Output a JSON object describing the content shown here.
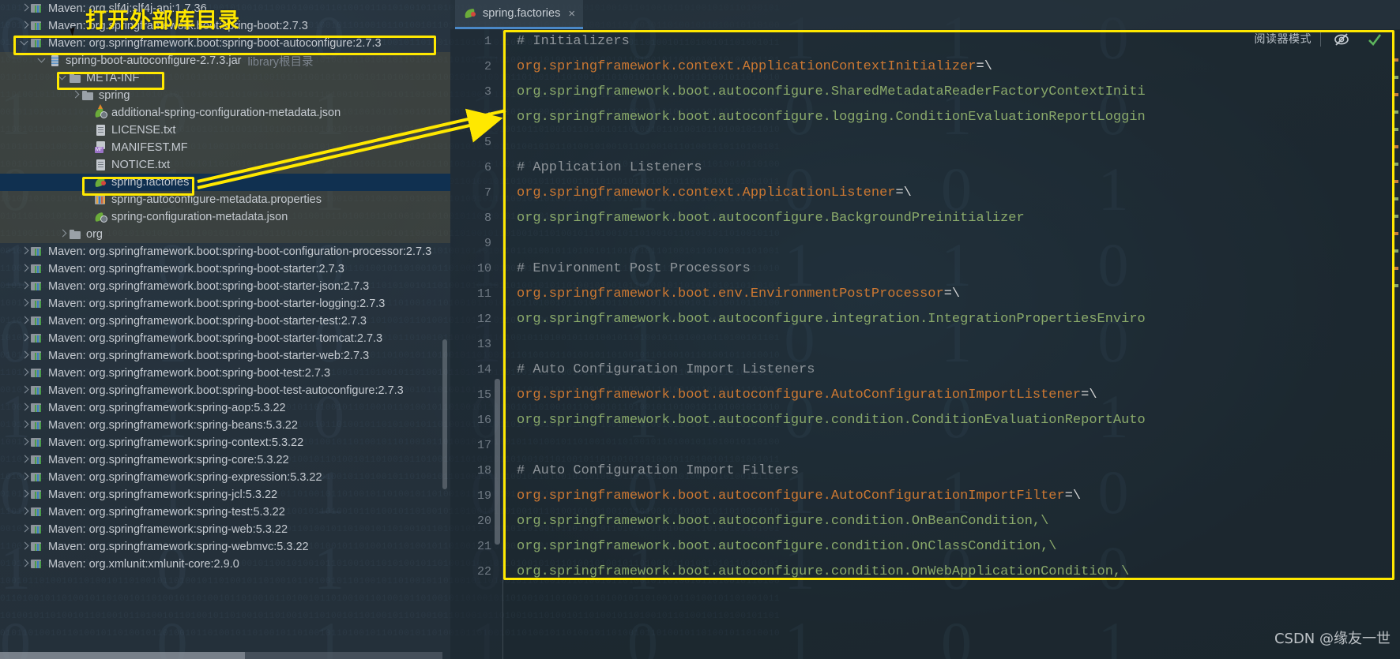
{
  "annotation": {
    "title": "打开外部库目录",
    "watermark": "CSDN @缘友一世",
    "highlight_color": "#ffe800"
  },
  "tree": {
    "items": [
      {
        "arrow": "right",
        "icon": "maven-library-icon",
        "label": "Maven: org.slf4j:slf4j-api:1.7.36",
        "indent": 24,
        "state": "normal"
      },
      {
        "arrow": "right",
        "icon": "maven-library-icon",
        "label": "Maven: org.springframework.boot:spring-boot:2.7.3",
        "indent": 24,
        "state": "normal"
      },
      {
        "arrow": "down",
        "icon": "maven-library-icon",
        "label": "Maven: org.springframework.boot:spring-boot-autoconfigure:2.7.3",
        "indent": 24,
        "state": "normal"
      },
      {
        "arrow": "down",
        "icon": "jar-icon",
        "label": "spring-boot-autoconfigure-2.7.3.jar",
        "suffix": "library根目录",
        "indent": 46,
        "state": "inside-jar"
      },
      {
        "arrow": "down",
        "icon": "folder-icon",
        "label": "META-INF",
        "indent": 72,
        "state": "inside-jar"
      },
      {
        "arrow": "right",
        "icon": "folder-icon",
        "label": "spring",
        "indent": 88,
        "state": "inside-jar"
      },
      {
        "arrow": "none",
        "icon": "spring-json-icon",
        "label": "additional-spring-configuration-metadata.json",
        "indent": 104,
        "state": "inside-jar"
      },
      {
        "arrow": "none",
        "icon": "text-file-icon",
        "label": "LICENSE.txt",
        "indent": 104,
        "state": "inside-jar"
      },
      {
        "arrow": "none",
        "icon": "manifest-file-icon",
        "label": "MANIFEST.MF",
        "indent": 104,
        "state": "inside-jar"
      },
      {
        "arrow": "none",
        "icon": "text-file-icon",
        "label": "NOTICE.txt",
        "indent": 104,
        "state": "inside-jar"
      },
      {
        "arrow": "none",
        "icon": "spring-leaf-icon",
        "label": "spring.factories",
        "indent": 104,
        "state": "selected"
      },
      {
        "arrow": "none",
        "icon": "properties-file-icon",
        "label": "spring-autoconfigure-metadata.properties",
        "indent": 104,
        "state": "inside-jar"
      },
      {
        "arrow": "none",
        "icon": "spring-json-icon",
        "label": "spring-configuration-metadata.json",
        "indent": 104,
        "state": "inside-jar"
      },
      {
        "arrow": "right",
        "icon": "folder-icon",
        "label": "org",
        "indent": 72,
        "state": "inside-jar"
      },
      {
        "arrow": "right",
        "icon": "maven-library-icon",
        "label": "Maven: org.springframework.boot:spring-boot-configuration-processor:2.7.3",
        "indent": 24,
        "state": "normal"
      },
      {
        "arrow": "right",
        "icon": "maven-library-icon",
        "label": "Maven: org.springframework.boot:spring-boot-starter:2.7.3",
        "indent": 24,
        "state": "normal"
      },
      {
        "arrow": "right",
        "icon": "maven-library-icon",
        "label": "Maven: org.springframework.boot:spring-boot-starter-json:2.7.3",
        "indent": 24,
        "state": "normal"
      },
      {
        "arrow": "right",
        "icon": "maven-library-icon",
        "label": "Maven: org.springframework.boot:spring-boot-starter-logging:2.7.3",
        "indent": 24,
        "state": "normal"
      },
      {
        "arrow": "right",
        "icon": "maven-library-icon",
        "label": "Maven: org.springframework.boot:spring-boot-starter-test:2.7.3",
        "indent": 24,
        "state": "normal"
      },
      {
        "arrow": "right",
        "icon": "maven-library-icon",
        "label": "Maven: org.springframework.boot:spring-boot-starter-tomcat:2.7.3",
        "indent": 24,
        "state": "normal"
      },
      {
        "arrow": "right",
        "icon": "maven-library-icon",
        "label": "Maven: org.springframework.boot:spring-boot-starter-web:2.7.3",
        "indent": 24,
        "state": "normal"
      },
      {
        "arrow": "right",
        "icon": "maven-library-icon",
        "label": "Maven: org.springframework.boot:spring-boot-test:2.7.3",
        "indent": 24,
        "state": "normal"
      },
      {
        "arrow": "right",
        "icon": "maven-library-icon",
        "label": "Maven: org.springframework.boot:spring-boot-test-autoconfigure:2.7.3",
        "indent": 24,
        "state": "normal"
      },
      {
        "arrow": "right",
        "icon": "maven-library-icon",
        "label": "Maven: org.springframework:spring-aop:5.3.22",
        "indent": 24,
        "state": "normal"
      },
      {
        "arrow": "right",
        "icon": "maven-library-icon",
        "label": "Maven: org.springframework:spring-beans:5.3.22",
        "indent": 24,
        "state": "normal"
      },
      {
        "arrow": "right",
        "icon": "maven-library-icon",
        "label": "Maven: org.springframework:spring-context:5.3.22",
        "indent": 24,
        "state": "normal"
      },
      {
        "arrow": "right",
        "icon": "maven-library-icon",
        "label": "Maven: org.springframework:spring-core:5.3.22",
        "indent": 24,
        "state": "normal"
      },
      {
        "arrow": "right",
        "icon": "maven-library-icon",
        "label": "Maven: org.springframework:spring-expression:5.3.22",
        "indent": 24,
        "state": "normal"
      },
      {
        "arrow": "right",
        "icon": "maven-library-icon",
        "label": "Maven: org.springframework:spring-jcl:5.3.22",
        "indent": 24,
        "state": "normal"
      },
      {
        "arrow": "right",
        "icon": "maven-library-icon",
        "label": "Maven: org.springframework:spring-test:5.3.22",
        "indent": 24,
        "state": "normal"
      },
      {
        "arrow": "right",
        "icon": "maven-library-icon",
        "label": "Maven: org.springframework:spring-web:5.3.22",
        "indent": 24,
        "state": "normal"
      },
      {
        "arrow": "right",
        "icon": "maven-library-icon",
        "label": "Maven: org.springframework:spring-webmvc:5.3.22",
        "indent": 24,
        "state": "normal"
      },
      {
        "arrow": "right",
        "icon": "maven-library-icon",
        "label": "Maven: org.xmlunit:xmlunit-core:2.9.0",
        "indent": 24,
        "state": "normal"
      }
    ]
  },
  "editor": {
    "tab": {
      "label": "spring.factories",
      "icon": "spring-leaf-icon",
      "close": "×"
    },
    "reader_mode_label": "阅读器模式",
    "lines": [
      {
        "n": 1,
        "kind": "comment",
        "text": "# Initializers"
      },
      {
        "n": 2,
        "kind": "kv",
        "key": "org.springframework.context.ApplicationContextInitializer",
        "eq": "=\\",
        "val": ""
      },
      {
        "n": 3,
        "kind": "val",
        "val": "org.springframework.boot.autoconfigure.SharedMetadataReaderFactoryContextIniti"
      },
      {
        "n": 4,
        "kind": "val",
        "val": "org.springframework.boot.autoconfigure.logging.ConditionEvaluationReportLoggin"
      },
      {
        "n": 5,
        "kind": "blank",
        "text": ""
      },
      {
        "n": 6,
        "kind": "comment",
        "text": "# Application Listeners"
      },
      {
        "n": 7,
        "kind": "kv",
        "key": "org.springframework.context.ApplicationListener",
        "eq": "=\\",
        "val": ""
      },
      {
        "n": 8,
        "kind": "val",
        "val": "org.springframework.boot.autoconfigure.BackgroundPreinitializer"
      },
      {
        "n": 9,
        "kind": "blank",
        "text": ""
      },
      {
        "n": 10,
        "kind": "comment",
        "text": "# Environment Post Processors"
      },
      {
        "n": 11,
        "kind": "kv",
        "key": "org.springframework.boot.env.EnvironmentPostProcessor",
        "eq": "=\\",
        "val": ""
      },
      {
        "n": 12,
        "kind": "val",
        "val": "org.springframework.boot.autoconfigure.integration.IntegrationPropertiesEnviro"
      },
      {
        "n": 13,
        "kind": "blank",
        "text": ""
      },
      {
        "n": 14,
        "kind": "comment",
        "text": "# Auto Configuration Import Listeners"
      },
      {
        "n": 15,
        "kind": "kv",
        "key": "org.springframework.boot.autoconfigure.AutoConfigurationImportListener",
        "eq": "=\\",
        "val": ""
      },
      {
        "n": 16,
        "kind": "val",
        "val": "org.springframework.boot.autoconfigure.condition.ConditionEvaluationReportAuto"
      },
      {
        "n": 17,
        "kind": "blank",
        "text": ""
      },
      {
        "n": 18,
        "kind": "comment",
        "text": "# Auto Configuration Import Filters"
      },
      {
        "n": 19,
        "kind": "kv",
        "key": "org.springframework.boot.autoconfigure.AutoConfigurationImportFilter",
        "eq": "=\\",
        "val": ""
      },
      {
        "n": 20,
        "kind": "val",
        "val": "org.springframework.boot.autoconfigure.condition.OnBeanCondition,\\"
      },
      {
        "n": 21,
        "kind": "val",
        "val": "org.springframework.boot.autoconfigure.condition.OnClassCondition,\\"
      },
      {
        "n": 22,
        "kind": "val",
        "val": "org.springframework.boot.autoconfigure.condition.OnWebApplicationCondition,\\"
      }
    ]
  }
}
